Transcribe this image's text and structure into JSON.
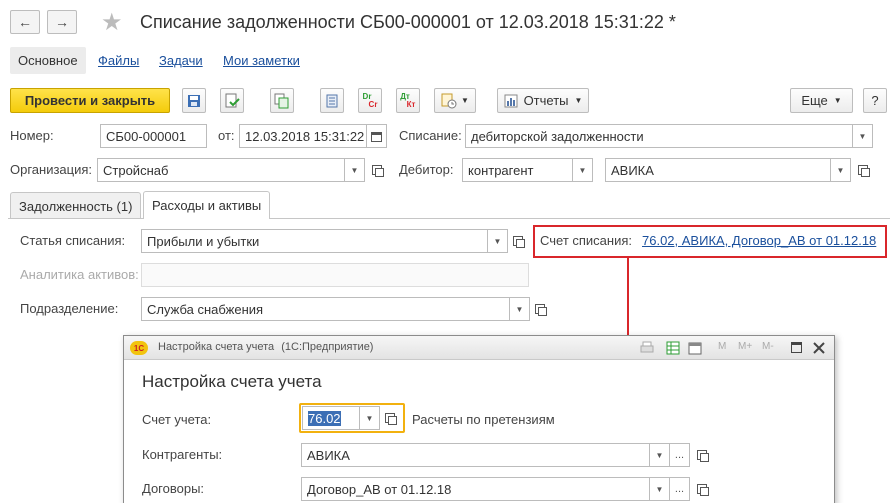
{
  "header": {
    "back_glyph": "←",
    "forward_glyph": "→",
    "star_glyph": "★",
    "title": "Списание задолженности СБ00-000001 от 12.03.2018 15:31:22 *"
  },
  "nav_tabs": {
    "main": "Основное",
    "files": "Файлы",
    "tasks": "Задачи",
    "notes": "Мои заметки"
  },
  "toolbar": {
    "post_close": "Провести и закрыть",
    "dr_top": "Dr",
    "dr_bottom": "Cr",
    "dt_top": "Дт",
    "dt_bottom": "Кт",
    "reports": "Отчеты",
    "more": "Еще",
    "help": "?"
  },
  "form": {
    "number_label": "Номер:",
    "number_value": "СБ00-000001",
    "date_label": "от:",
    "date_value": "12.03.2018 15:31:22",
    "writeoff_label": "Списание:",
    "writeoff_value": "дебиторской задолженности",
    "org_label": "Организация:",
    "org_value": "Стройснаб",
    "debtor_label": "Дебитор:",
    "debtor_type": "контрагент",
    "debtor_value": "АВИКА"
  },
  "tabs": {
    "debt": "Задолженность (1)",
    "expenses": "Расходы и активы"
  },
  "expenses": {
    "article_label": "Статья списания:",
    "article_value": "Прибыли и убытки",
    "analytics_label": "Аналитика активов:",
    "analytics_value": "",
    "dept_label": "Подразделение:",
    "dept_value": "Служба снабжения",
    "account_label": "Счет списания:",
    "account_link": "76.02, АВИКА, Договор_АВ от 01.12.18"
  },
  "dialog": {
    "logo": "1С",
    "window_title": "Настройка счета учета",
    "window_title_suffix": "(1С:Предприятие)",
    "tb_m": "M",
    "tb_mplus": "M+",
    "tb_mminus": "M-",
    "heading": "Настройка счета учета",
    "account_label": "Счет учета:",
    "account_value": "76.02",
    "account_name": "Расчеты по претензиям",
    "contractors_label": "Контрагенты:",
    "contractors_value": "АВИКА",
    "contracts_label": "Договоры:",
    "contracts_value": "Договор_АВ от 01.12.18",
    "ellipsis": "..."
  },
  "colors": {
    "primary_button": "#f4cc0b",
    "link": "#1a4f9c",
    "highlight_border": "#d9262b",
    "focus_border": "#f2b10f"
  }
}
